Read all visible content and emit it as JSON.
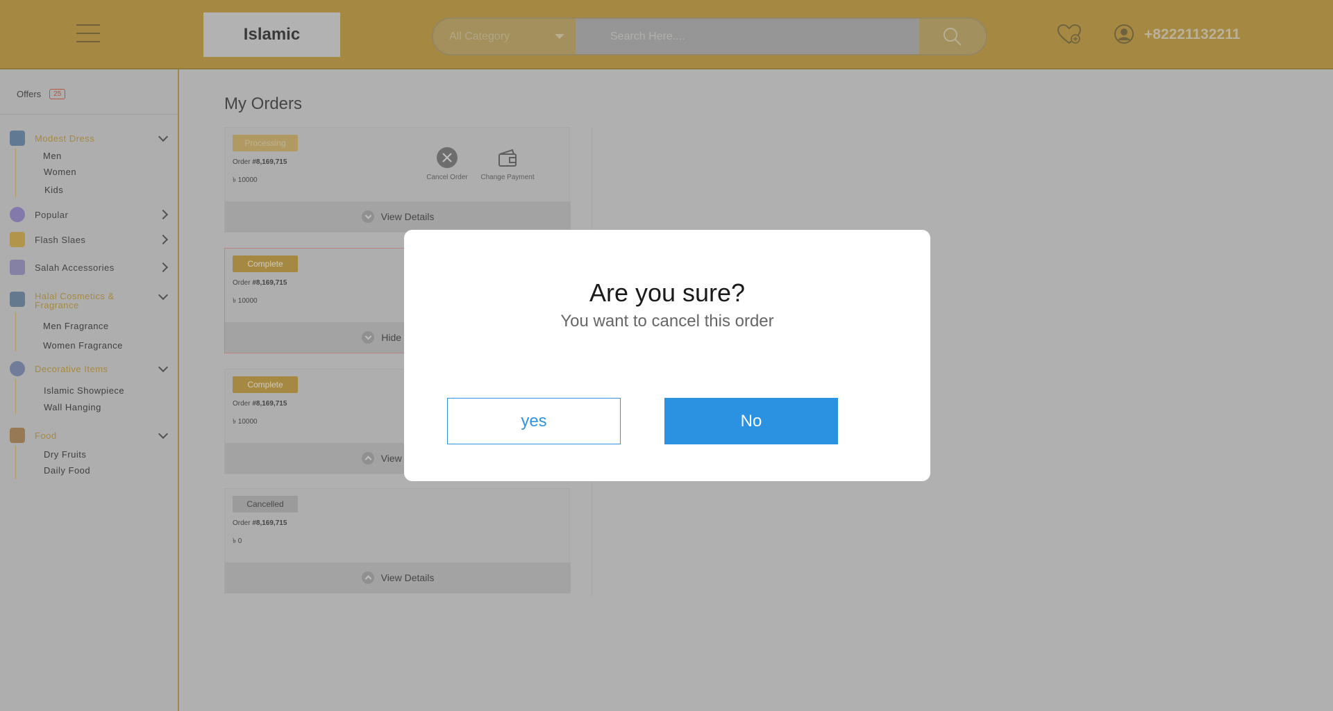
{
  "header": {
    "logo": "Islamic",
    "category_select": "All Category",
    "search_placeholder": "Search Here....",
    "phone": "+82221132211"
  },
  "sidebar": {
    "offers_label": "Offers",
    "offers_count": "25",
    "categories": [
      {
        "label": "Modest Dress",
        "subs": [
          "Men",
          "Women",
          "Kids"
        ]
      },
      {
        "label": "Popular"
      },
      {
        "label": "Flash Slaes"
      },
      {
        "label": "Salah Accessories"
      },
      {
        "label": "Halal Cosmetics & Fragrance",
        "subs": [
          "Men Fragrance",
          "Women Fragrance"
        ]
      },
      {
        "label": "Decorative Items",
        "subs": [
          "Islamic Showpiece",
          "Wall Hanging"
        ]
      },
      {
        "label": "Food",
        "subs": [
          "Dry Fruits",
          "Daily Food"
        ]
      }
    ]
  },
  "main": {
    "title": "My Orders",
    "orders": [
      {
        "status": "Processing",
        "order_prefix": "Order",
        "order_no": "#8,169,715",
        "amount": "৳ 10000",
        "footer": "View Details",
        "actions": [
          "Cancel Order",
          "Change Payment"
        ]
      },
      {
        "status": "Complete",
        "order_prefix": "Order",
        "order_no": "#8,169,715",
        "amount": "৳ 10000",
        "footer": "Hide Details"
      },
      {
        "status": "Complete",
        "order_prefix": "Order",
        "order_no": "#8,169,715",
        "amount": "৳ 10000",
        "footer": "View Details"
      },
      {
        "status": "Cancelled",
        "order_prefix": "Order",
        "order_no": "#8,169,715",
        "amount": "৳ 0",
        "footer": "View Details"
      }
    ]
  },
  "modal": {
    "title": "Are you sure?",
    "subtitle": "You want to cancel this order",
    "yes_label": "yes",
    "no_label": "No"
  },
  "colors": {
    "header_bg": "#b8902e",
    "accent": "#b8902e",
    "primary_button": "#2b92e2"
  }
}
